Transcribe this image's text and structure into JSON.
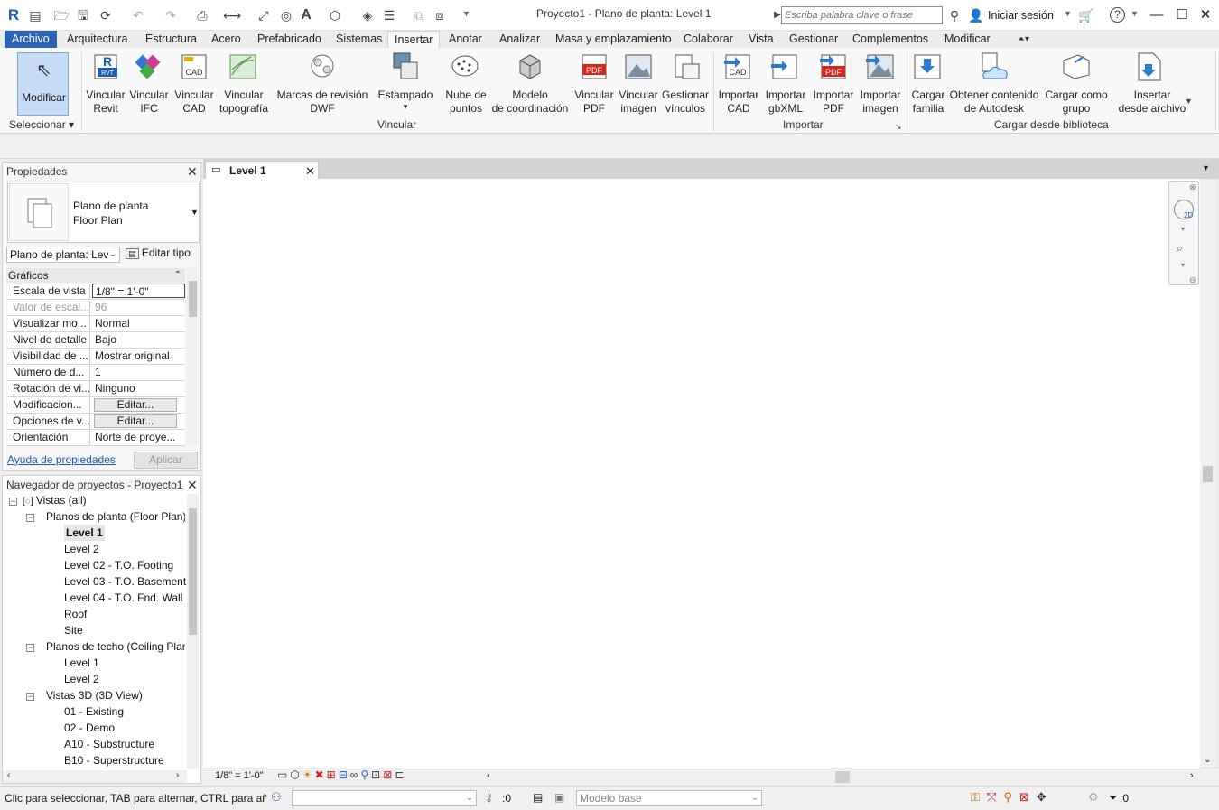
{
  "title_bar": {
    "window_title": "Proyecto1 - Plano de planta: Level 1",
    "search_placeholder": "Escriba palabra clave o frase",
    "sign_in": "Iniciar sesión",
    "help": "?"
  },
  "tabs": [
    {
      "label": "Archivo"
    },
    {
      "label": "Arquitectura"
    },
    {
      "label": "Estructura"
    },
    {
      "label": "Acero"
    },
    {
      "label": "Prefabricado"
    },
    {
      "label": "Sistemas"
    },
    {
      "label": "Insertar"
    },
    {
      "label": "Anotar"
    },
    {
      "label": "Analizar"
    },
    {
      "label": "Masa y emplazamiento"
    },
    {
      "label": "Colaborar"
    },
    {
      "label": "Vista"
    },
    {
      "label": "Gestionar"
    },
    {
      "label": "Complementos"
    },
    {
      "label": "Modificar"
    }
  ],
  "active_tab": "Insertar",
  "ribbon": {
    "modify": {
      "label": "Modificar"
    },
    "select_group": "Seleccionar",
    "link_group": "Vincular",
    "import_group": "Importar",
    "library_group": "Cargar desde biblioteca",
    "buttons": [
      {
        "label": "Vincular",
        "label2": "Revit",
        "icon": "revit-link-icon"
      },
      {
        "label": "Vincular",
        "label2": "IFC",
        "icon": "ifc-link-icon"
      },
      {
        "label": "Vincular",
        "label2": "CAD",
        "icon": "cad-link-icon"
      },
      {
        "label": "Vincular",
        "label2": "topografía",
        "icon": "topography-icon"
      },
      {
        "label": "Marcas de revisión",
        "label2": "DWF",
        "icon": "dwf-markup-icon"
      },
      {
        "label": "Estampado",
        "label2": "",
        "icon": "decal-icon"
      },
      {
        "label": "Nube de",
        "label2": "puntos",
        "icon": "point-cloud-icon"
      },
      {
        "label": "Modelo",
        "label2": "de coordinación",
        "icon": "coordination-model-icon"
      },
      {
        "label": "Vincular",
        "label2": "PDF",
        "icon": "pdf-link-icon"
      },
      {
        "label": "Vincular",
        "label2": "imagen",
        "icon": "image-link-icon"
      },
      {
        "label": "Gestionar",
        "label2": "vínculos",
        "icon": "manage-links-icon"
      },
      {
        "label": "Importar",
        "label2": "CAD",
        "icon": "cad-import-icon"
      },
      {
        "label": "Importar",
        "label2": "gbXML",
        "icon": "gbxml-icon"
      },
      {
        "label": "Importar",
        "label2": "PDF",
        "icon": "pdf-import-icon"
      },
      {
        "label": "Importar",
        "label2": "imagen",
        "icon": "image-import-icon"
      },
      {
        "label": "Cargar",
        "label2": "familia",
        "icon": "load-family-icon"
      },
      {
        "label": "Obtener contenido",
        "label2": "de Autodesk",
        "icon": "autodesk-cloud-icon"
      },
      {
        "label": "Cargar como",
        "label2": "grupo",
        "icon": "load-group-icon"
      },
      {
        "label": "Insertar",
        "label2": "desde archivo",
        "icon": "insert-file-icon"
      }
    ],
    "cad_badge": "CAD",
    "pdf_badge": "PDF",
    "rvt_badge": "RVT"
  },
  "properties": {
    "panel_title": "Propiedades",
    "type_name": "Plano de planta",
    "type_sub": "Floor Plan",
    "instance_select": "Plano de planta: Lev",
    "edit_type": "Editar tipo",
    "section": "Gráficos",
    "rows": [
      {
        "key": "Escala de vista",
        "value": "1/8\" = 1'-0\""
      },
      {
        "key": "Valor de escal...",
        "value": "96"
      },
      {
        "key": "Visualizar mo...",
        "value": "Normal"
      },
      {
        "key": "Nivel de detalle",
        "value": "Bajo"
      },
      {
        "key": "Visibilidad de ...",
        "value": "Mostrar original"
      },
      {
        "key": "Número de d...",
        "value": "1"
      },
      {
        "key": "Rotación de vi...",
        "value": "Ninguno"
      },
      {
        "key": "Modificacion...",
        "value": "Editar..."
      },
      {
        "key": "Opciones de v...",
        "value": "Editar..."
      },
      {
        "key": "Orientación",
        "value": "Norte de proye..."
      }
    ],
    "help_link": "Ayuda de propiedades",
    "apply": "Aplicar"
  },
  "navigator": {
    "panel_title": "Navegador de proyectos - Proyecto1",
    "root": "Vistas (all)",
    "floor_plans": "Planos de planta (Floor Plan)",
    "floor_items": [
      "Level 1",
      "Level 2",
      "Level 02 - T.O. Footing",
      "Level 03 - T.O. Basement",
      "Level 04 - T.O. Fnd. Wall",
      "Roof",
      "Site"
    ],
    "ceiling_plans": "Planos de techo (Ceiling Plan)",
    "ceiling_items": [
      "Level 1",
      "Level 2"
    ],
    "views_3d": "Vistas 3D (3D View)",
    "views_3d_items": [
      "01 - Existing",
      "02 - Demo",
      "A10 - Substructure",
      "B10 - Superstructure"
    ]
  },
  "view": {
    "tab_label": "Level 1",
    "scale": "1/8\" = 1'-0\"",
    "nav_2d": "2D"
  },
  "status": {
    "message": "Clic para seleccionar, TAB para alternar, CTRL para añad",
    "worksets_count": ":0",
    "model": "Modelo base",
    "filter_count": ":0"
  },
  "colors": {
    "file_tab": "#2a63b8",
    "modify_bg": "#c5dcf4",
    "pdf_red": "#d9261c",
    "revit_blue": "#1b5fb1"
  }
}
